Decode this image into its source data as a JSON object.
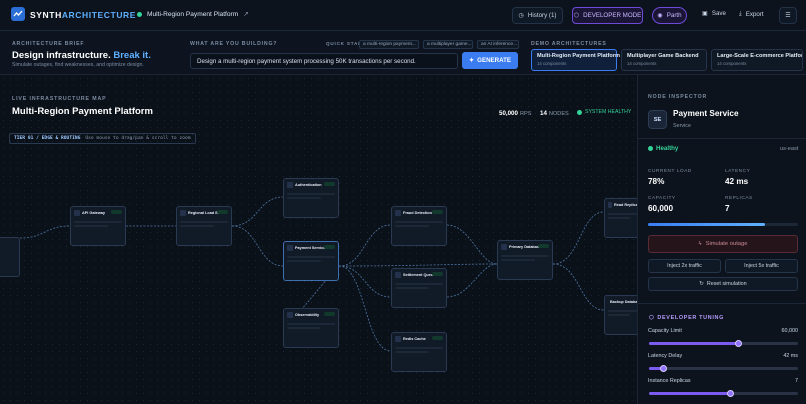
{
  "header": {
    "brand_a": "SYNTH",
    "brand_b": "ARCHITECTURE",
    "project": "Multi-Region Payment Platform",
    "history": "History (1)",
    "developer_mode": "DEVELOPER MODE",
    "user": "Parth",
    "save": "Save",
    "export": "Export"
  },
  "brief": {
    "label": "ARCHITECTURE BRIEF",
    "title_a": "Design infrastructure.",
    "title_b": "Break it.",
    "subtitle": "Simulate outages, find weaknesses, and optimize design.",
    "building_label": "WHAT ARE YOU BUILDING?",
    "quick_start_label": "QUICK START:",
    "quick_starts": [
      "a multi-region payment...",
      "a multiplayer game...",
      "an AI inference..."
    ],
    "prompt_value": "Design a multi-region payment system processing 50K transactions per second.",
    "generate": "GENERATE",
    "demo_label": "DEMO ARCHITECTURES",
    "demos": [
      {
        "title": "Multi-Region Payment Platform",
        "count": "14 components"
      },
      {
        "title": "Multiplayer Game Backend",
        "count": "14 components"
      },
      {
        "title": "Large-Scale E-commerce Platform",
        "count": "14 components"
      }
    ]
  },
  "map": {
    "label": "LIVE INFRASTRUCTURE MAP",
    "title": "Multi-Region Payment Platform",
    "rps_value": "50,000",
    "rps_unit": "RPS",
    "nodes_value": "14",
    "nodes_unit": "NODES",
    "health": "SYSTEM HEALTHY",
    "tier_label": "TIER 01 / EDGE & ROUTING",
    "tier_hint": "Use mouse to drag/pan & scroll to zoom",
    "nodes": [
      {
        "title": "API Gateway"
      },
      {
        "title": "Regional Load B..."
      },
      {
        "title": "Authentication"
      },
      {
        "title": "Payment Service"
      },
      {
        "title": "Observability"
      },
      {
        "title": "Fraud Detection"
      },
      {
        "title": "Settlement Queue"
      },
      {
        "title": "Redis Cache"
      },
      {
        "title": "Primary Database"
      },
      {
        "title": "Read Replicas"
      },
      {
        "title": "Backup Databa..."
      }
    ]
  },
  "inspector": {
    "label": "NODE INSPECTOR",
    "icon": "SE",
    "name": "Payment Service",
    "type": "Service",
    "status": "Healthy",
    "region": "us-east",
    "current_load_label": "CURRENT LOAD",
    "current_load": "78%",
    "latency_label": "LATENCY",
    "latency": "42 ms",
    "capacity_label": "CAPACITY",
    "capacity": "60,000",
    "replicas_label": "REPLICAS",
    "replicas": "7",
    "load_fraction": 0.78,
    "simulate_outage": "Simulate outage",
    "inject_2x": "Inject 2x traffic",
    "inject_5x": "Inject 5x traffic",
    "reset": "Reset simulation",
    "tuning_label": "DEVELOPER TUNING",
    "sliders": [
      {
        "label": "Capacity Limit",
        "value": "60,000",
        "fraction": 0.6
      },
      {
        "label": "Latency Delay",
        "value": "42 ms",
        "fraction": 0.1
      },
      {
        "label": "Instance Replicas",
        "value": "7",
        "fraction": 0.55
      }
    ]
  },
  "colors": {
    "accent": "#3b7df0",
    "healthy": "#34d399",
    "dev": "#7c5cf0"
  }
}
